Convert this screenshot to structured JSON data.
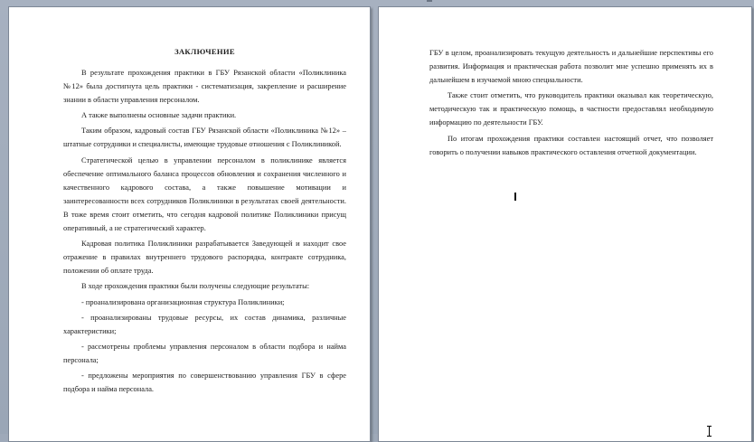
{
  "left_page": {
    "title": "ЗАКЛЮЧЕНИЕ",
    "paragraphs": [
      "В результате прохождения практики в ГБУ Рязанской области «Поликлиника №12» была достигнута цель практики - систематизация, закрепление и расширение знании в области управления персоналом.",
      "А также выполнены основные задачи практики.",
      "Таким образом, кадровый состав ГБУ Рязанской области «Поликлиника №12» – штатные сотрудники и специалисты, имеющие трудовые отношения с Поликлиникой.",
      "Стратегической целью в управлении персоналом в поликлинике является обеспечение оптимального баланса процессов обновления и сохранения численного и качественного кадрового состава, а также повышение мотивации и заинтересованности всех сотрудников Поликлиники в результатах своей деятельности. В тоже время стоит отметить, что сегодня кадровой политике Поликлиники присущ оперативный, а не стратегический характер.",
      "Кадровая политика Поликлиники разрабатывается Заведующей и находит свое отражение в правилах внутреннего трудового распорядка, контракте сотрудника, положении об оплате труда.",
      "В ходе прохождения практики были получены следующие результаты:"
    ],
    "list_items": [
      "- проанализирована организационная структура Поликлиники;",
      "- проанализированы трудовые ресурсы, их состав динамика, различные характеристики;",
      "- рассмотрены проблемы управления персоналом в области подбора и найма персонала;",
      "- предложены мероприятия по совершенствованию управления ГБУ в сфере подбора и найма персонала."
    ]
  },
  "right_page": {
    "paragraphs_cont": [
      "ГБУ в целом, проанализировать текущую деятельность и дальнейшие перспективы его развития. Информация и практическая работа позволит мне успешно применять их в дальнейшем в изучаемой мною специальности."
    ],
    "paragraphs": [
      "Также стоит отметить, что руководитель практики оказывал как теоретическую, методическую так и практическую помощь, в частности предоставлял необходимую информацию по деятельности ГБУ.",
      "По итогам прохождения практики составлен настоящий отчет, что позволяет говорить о получении навыков практического оставления отчетной документации."
    ]
  }
}
